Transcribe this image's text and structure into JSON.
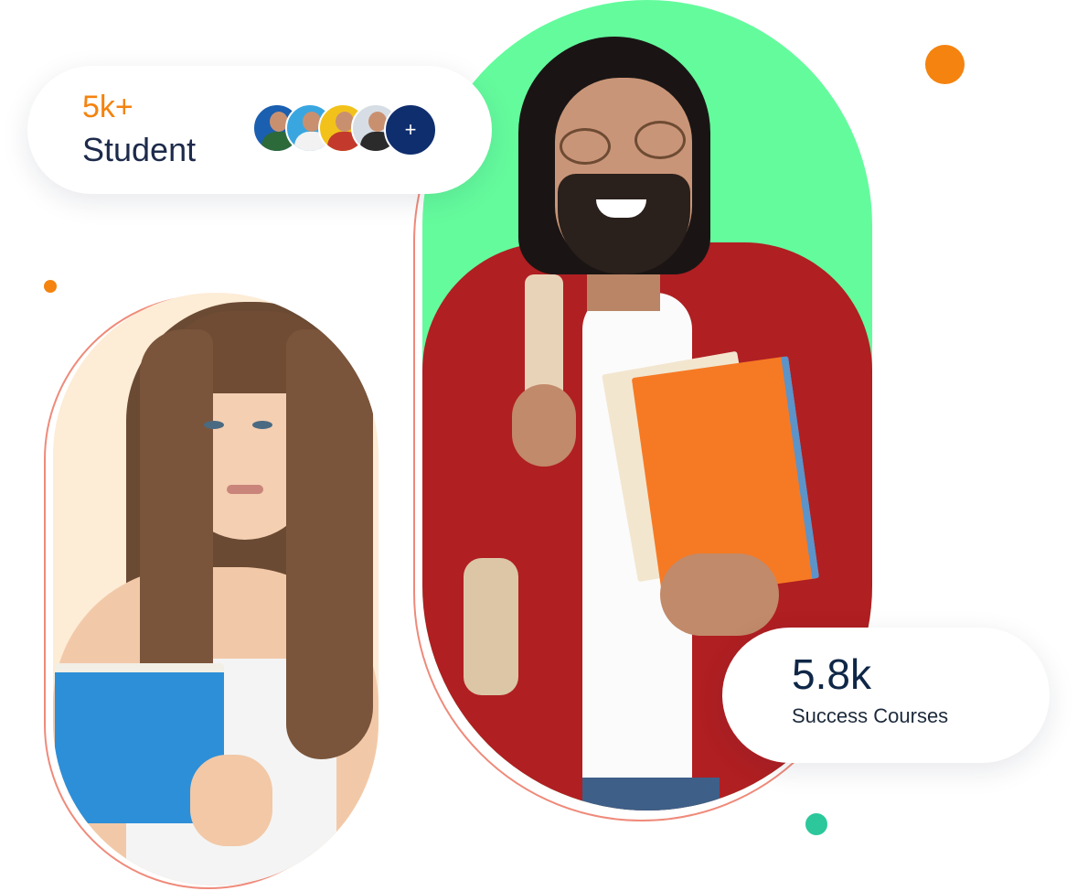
{
  "students_card": {
    "count": "5k+",
    "label": "Student",
    "more_symbol": "+",
    "avatars": [
      {
        "name": "student-avatar-1",
        "bg": "#1a5fb0",
        "shirt": "#2d6a3a"
      },
      {
        "name": "student-avatar-2",
        "bg": "#3aa6e0",
        "shirt": "#f2f2f2"
      },
      {
        "name": "student-avatar-3",
        "bg": "#f2c21b",
        "shirt": "#c33a2c"
      },
      {
        "name": "student-avatar-4",
        "bg": "#d7dde4",
        "shirt": "#2b2b2b"
      }
    ],
    "count_color": "#f4830f",
    "label_color": "#1d2a4b",
    "more_bg": "#0f2e6e"
  },
  "courses_card": {
    "count": "5.8k",
    "label": "Success Courses",
    "count_color": "#0f2747"
  },
  "photos": {
    "left_photo": {
      "subject": "female-student-holding-blue-notebook",
      "bg": "#fdecd6"
    },
    "right_photo": {
      "subject": "male-student-holding-orange-notebooks",
      "bg": "#64fb9d"
    }
  },
  "accents": {
    "orange": "#f4830f",
    "teal": "#2cc79b",
    "frame_outline": "#ef8a7a"
  }
}
